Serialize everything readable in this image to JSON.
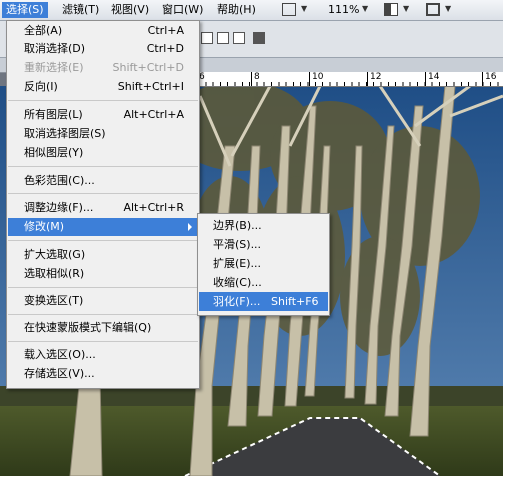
{
  "menubar": {
    "items": [
      "选择(S)",
      "滤镜(T)",
      "视图(V)",
      "窗口(W)",
      "帮助(H)"
    ],
    "zoom": "111%"
  },
  "ruler": {
    "labels": [
      "6",
      "8",
      "10",
      "12",
      "14",
      "16"
    ]
  },
  "select_menu": {
    "items": [
      {
        "label": "全部(A)",
        "shortcut": "Ctrl+A"
      },
      {
        "label": "取消选择(D)",
        "shortcut": "Ctrl+D"
      },
      {
        "label": "重新选择(E)",
        "shortcut": "Shift+Ctrl+D"
      },
      {
        "label": "反向(I)",
        "shortcut": "Shift+Ctrl+I"
      },
      {
        "label": "所有图层(L)",
        "shortcut": "Alt+Ctrl+A"
      },
      {
        "label": "取消选择图层(S)",
        "shortcut": ""
      },
      {
        "label": "相似图层(Y)",
        "shortcut": ""
      },
      {
        "label": "色彩范围(C)...",
        "shortcut": ""
      },
      {
        "label": "调整边缘(F)...",
        "shortcut": "Alt+Ctrl+R"
      },
      {
        "label": "修改(M)",
        "shortcut": ""
      },
      {
        "label": "扩大选取(G)",
        "shortcut": ""
      },
      {
        "label": "选取相似(R)",
        "shortcut": ""
      },
      {
        "label": "变换选区(T)",
        "shortcut": ""
      },
      {
        "label": "在快速蒙版模式下编辑(Q)",
        "shortcut": ""
      },
      {
        "label": "载入选区(O)...",
        "shortcut": ""
      },
      {
        "label": "存储选区(V)...",
        "shortcut": ""
      }
    ]
  },
  "modify_submenu": {
    "items": [
      {
        "label": "边界(B)...",
        "shortcut": ""
      },
      {
        "label": "平滑(S)...",
        "shortcut": ""
      },
      {
        "label": "扩展(E)...",
        "shortcut": ""
      },
      {
        "label": "收缩(C)...",
        "shortcut": ""
      },
      {
        "label": "羽化(F)...",
        "shortcut": "Shift+F6"
      }
    ]
  },
  "colors": {
    "highlight": "#3d7fd8",
    "menu_bg": "#f0f0f0",
    "sky": "#2d5f93",
    "bark": "#c7c0a8"
  }
}
